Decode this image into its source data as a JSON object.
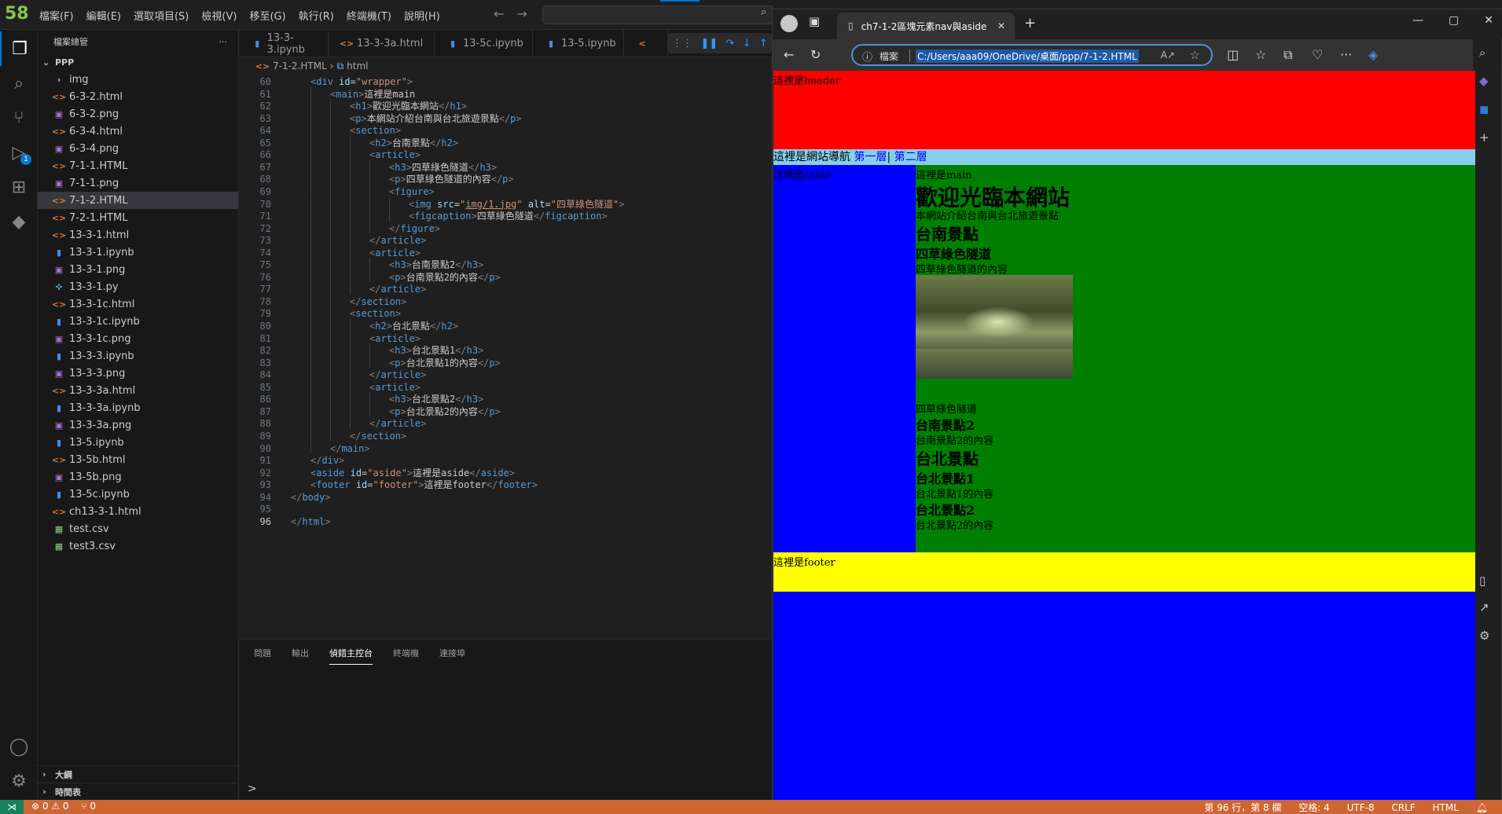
{
  "vscode": {
    "logo": "58",
    "menu": [
      "檔案(F)",
      "編輯(E)",
      "選取項目(S)",
      "檢視(V)",
      "移至(G)",
      "執行(R)",
      "終端機(T)",
      "說明(H)"
    ],
    "explorer": {
      "title": "檔案總管",
      "more": "···",
      "root": "PPP",
      "files": [
        {
          "name": "img",
          "type": "dir"
        },
        {
          "name": "6-3-2.html",
          "type": "html"
        },
        {
          "name": "6-3-2.png",
          "type": "png"
        },
        {
          "name": "6-3-4.html",
          "type": "html"
        },
        {
          "name": "6-3-4.png",
          "type": "png"
        },
        {
          "name": "7-1-1.HTML",
          "type": "html"
        },
        {
          "name": "7-1-1.png",
          "type": "png"
        },
        {
          "name": "7-1-2.HTML",
          "type": "html",
          "selected": true
        },
        {
          "name": "7-2-1.HTML",
          "type": "html"
        },
        {
          "name": "13-3-1.html",
          "type": "html"
        },
        {
          "name": "13-3-1.ipynb",
          "type": "ipynb"
        },
        {
          "name": "13-3-1.png",
          "type": "png"
        },
        {
          "name": "13-3-1.py",
          "type": "py"
        },
        {
          "name": "13-3-1c.html",
          "type": "html"
        },
        {
          "name": "13-3-1c.ipynb",
          "type": "ipynb"
        },
        {
          "name": "13-3-1c.png",
          "type": "png"
        },
        {
          "name": "13-3-3.ipynb",
          "type": "ipynb"
        },
        {
          "name": "13-3-3.png",
          "type": "png"
        },
        {
          "name": "13-3-3a.html",
          "type": "html"
        },
        {
          "name": "13-3-3a.ipynb",
          "type": "ipynb"
        },
        {
          "name": "13-3-3a.png",
          "type": "png"
        },
        {
          "name": "13-5.ipynb",
          "type": "ipynb"
        },
        {
          "name": "13-5b.html",
          "type": "html"
        },
        {
          "name": "13-5b.png",
          "type": "png"
        },
        {
          "name": "13-5c.ipynb",
          "type": "ipynb"
        },
        {
          "name": "ch13-3-1.html",
          "type": "html"
        },
        {
          "name": "test.csv",
          "type": "csv"
        },
        {
          "name": "test3.csv",
          "type": "csv"
        }
      ],
      "outline": "大綱",
      "timeline": "時間表"
    },
    "tabs": [
      "13-3-3.ipynb",
      "13-3-3a.html",
      "13-5c.ipynb",
      "13-5.ipynb"
    ],
    "breadcrumb": {
      "file": "7-1-2.HTML",
      "node": "html"
    },
    "code_lines": [
      {
        "n": "60",
        "indent": 1,
        "html": "<span class='t-br'>&lt;</span><span class='t-tag'>div</span> <span class='t-attr'>id</span>=<span class='t-str'>\"wrapper\"</span><span class='t-br'>&gt;</span>"
      },
      {
        "n": "61",
        "indent": 2,
        "html": "<span class='t-br'>&lt;</span><span class='t-tag'>main</span><span class='t-br'>&gt;</span>這裡是main"
      },
      {
        "n": "62",
        "indent": 3,
        "html": "<span class='t-br'>&lt;</span><span class='t-tag'>h1</span><span class='t-br'>&gt;</span>歡迎光臨本網站<span class='t-br'>&lt;/</span><span class='t-tag'>h1</span><span class='t-br'>&gt;</span>"
      },
      {
        "n": "63",
        "indent": 3,
        "html": "<span class='t-br'>&lt;</span><span class='t-tag'>p</span><span class='t-br'>&gt;</span>本網站介紹台南與台北旅遊景點<span class='t-br'>&lt;/</span><span class='t-tag'>p</span><span class='t-br'>&gt;</span>"
      },
      {
        "n": "64",
        "indent": 3,
        "html": "<span class='t-br'>&lt;</span><span class='t-tag'>section</span><span class='t-br'>&gt;</span>"
      },
      {
        "n": "65",
        "indent": 4,
        "html": "<span class='t-br'>&lt;</span><span class='t-tag'>h2</span><span class='t-br'>&gt;</span>台南景點<span class='t-br'>&lt;/</span><span class='t-tag'>h2</span><span class='t-br'>&gt;</span>"
      },
      {
        "n": "66",
        "indent": 4,
        "html": "<span class='t-br'>&lt;</span><span class='t-tag'>article</span><span class='t-br'>&gt;</span>"
      },
      {
        "n": "67",
        "indent": 5,
        "html": "<span class='t-br'>&lt;</span><span class='t-tag'>h3</span><span class='t-br'>&gt;</span>四草綠色隧道<span class='t-br'>&lt;/</span><span class='t-tag'>h3</span><span class='t-br'>&gt;</span>"
      },
      {
        "n": "68",
        "indent": 5,
        "html": "<span class='t-br'>&lt;</span><span class='t-tag'>p</span><span class='t-br'>&gt;</span>四草綠色隧道的內容<span class='t-br'>&lt;/</span><span class='t-tag'>p</span><span class='t-br'>&gt;</span>"
      },
      {
        "n": "69",
        "indent": 5,
        "html": "<span class='t-br'>&lt;</span><span class='t-tag'>figure</span><span class='t-br'>&gt;</span>"
      },
      {
        "n": "70",
        "indent": 6,
        "html": "<span class='t-br'>&lt;</span><span class='t-tag'>img</span> <span class='t-attr'>src</span>=<span class='t-str'>\"<u>img/1.jpg</u>\"</span> <span class='t-attr'>alt</span>=<span class='t-str'>\"四草綠色隧道\"</span><span class='t-br'>&gt;</span>"
      },
      {
        "n": "71",
        "indent": 6,
        "html": "<span class='t-br'>&lt;</span><span class='t-tag'>figcaption</span><span class='t-br'>&gt;</span>四草綠色隧道<span class='t-br'>&lt;/</span><span class='t-tag'>figcaption</span><span class='t-br'>&gt;</span>"
      },
      {
        "n": "72",
        "indent": 5,
        "html": "<span class='t-br'>&lt;/</span><span class='t-tag'>figure</span><span class='t-br'>&gt;</span>"
      },
      {
        "n": "73",
        "indent": 4,
        "html": "<span class='t-br'>&lt;/</span><span class='t-tag'>article</span><span class='t-br'>&gt;</span>"
      },
      {
        "n": "74",
        "indent": 4,
        "html": "<span class='t-br'>&lt;</span><span class='t-tag'>article</span><span class='t-br'>&gt;</span>"
      },
      {
        "n": "75",
        "indent": 5,
        "html": "<span class='t-br'>&lt;</span><span class='t-tag'>h3</span><span class='t-br'>&gt;</span>台南景點2<span class='t-br'>&lt;/</span><span class='t-tag'>h3</span><span class='t-br'>&gt;</span>"
      },
      {
        "n": "76",
        "indent": 5,
        "html": "<span class='t-br'>&lt;</span><span class='t-tag'>p</span><span class='t-br'>&gt;</span>台南景點2的內容<span class='t-br'>&lt;/</span><span class='t-tag'>p</span><span class='t-br'>&gt;</span>"
      },
      {
        "n": "77",
        "indent": 4,
        "html": "<span class='t-br'>&lt;/</span><span class='t-tag'>article</span><span class='t-br'>&gt;</span>"
      },
      {
        "n": "78",
        "indent": 3,
        "html": "<span class='t-br'>&lt;/</span><span class='t-tag'>section</span><span class='t-br'>&gt;</span>"
      },
      {
        "n": "79",
        "indent": 3,
        "html": "<span class='t-br'>&lt;</span><span class='t-tag'>section</span><span class='t-br'>&gt;</span>"
      },
      {
        "n": "80",
        "indent": 4,
        "html": "<span class='t-br'>&lt;</span><span class='t-tag'>h2</span><span class='t-br'>&gt;</span>台北景點<span class='t-br'>&lt;/</span><span class='t-tag'>h2</span><span class='t-br'>&gt;</span>"
      },
      {
        "n": "81",
        "indent": 4,
        "html": "<span class='t-br'>&lt;</span><span class='t-tag'>article</span><span class='t-br'>&gt;</span>"
      },
      {
        "n": "82",
        "indent": 5,
        "html": "<span class='t-br'>&lt;</span><span class='t-tag'>h3</span><span class='t-br'>&gt;</span>台北景點1<span class='t-br'>&lt;/</span><span class='t-tag'>h3</span><span class='t-br'>&gt;</span>"
      },
      {
        "n": "83",
        "indent": 5,
        "html": "<span class='t-br'>&lt;</span><span class='t-tag'>p</span><span class='t-br'>&gt;</span>台北景點1的內容<span class='t-br'>&lt;/</span><span class='t-tag'>p</span><span class='t-br'>&gt;</span>"
      },
      {
        "n": "84",
        "indent": 4,
        "html": "<span class='t-br'>&lt;/</span><span class='t-tag'>article</span><span class='t-br'>&gt;</span>"
      },
      {
        "n": "85",
        "indent": 4,
        "html": "<span class='t-br'>&lt;</span><span class='t-tag'>article</span><span class='t-br'>&gt;</span>"
      },
      {
        "n": "86",
        "indent": 5,
        "html": "<span class='t-br'>&lt;</span><span class='t-tag'>h3</span><span class='t-br'>&gt;</span>台北景點2<span class='t-br'>&lt;/</span><span class='t-tag'>h3</span><span class='t-br'>&gt;</span>"
      },
      {
        "n": "87",
        "indent": 5,
        "html": "<span class='t-br'>&lt;</span><span class='t-tag'>p</span><span class='t-br'>&gt;</span>台北景點2的內容<span class='t-br'>&lt;/</span><span class='t-tag'>p</span><span class='t-br'>&gt;</span>"
      },
      {
        "n": "88",
        "indent": 4,
        "html": "<span class='t-br'>&lt;/</span><span class='t-tag'>article</span><span class='t-br'>&gt;</span>"
      },
      {
        "n": "89",
        "indent": 3,
        "html": "<span class='t-br'>&lt;/</span><span class='t-tag'>section</span><span class='t-br'>&gt;</span>"
      },
      {
        "n": "90",
        "indent": 2,
        "html": "<span class='t-br'>&lt;/</span><span class='t-tag'>main</span><span class='t-br'>&gt;</span>"
      },
      {
        "n": "91",
        "indent": 1,
        "html": "<span class='t-br'>&lt;/</span><span class='t-tag'>div</span><span class='t-br'>&gt;</span>"
      },
      {
        "n": "92",
        "indent": 1,
        "html": "<span class='t-br'>&lt;</span><span class='t-tag'>aside</span> <span class='t-attr'>id</span>=<span class='t-str'>\"aside\"</span><span class='t-br'>&gt;</span>這裡是aside<span class='t-br'>&lt;/</span><span class='t-tag'>aside</span><span class='t-br'>&gt;</span>"
      },
      {
        "n": "93",
        "indent": 1,
        "html": "<span class='t-br'>&lt;</span><span class='t-tag'>footer</span> <span class='t-attr'>id</span>=<span class='t-str'>\"footer\"</span><span class='t-br'>&gt;</span>這裡是footer<span class='t-br'>&lt;/</span><span class='t-tag'>footer</span><span class='t-br'>&gt;</span>"
      },
      {
        "n": "94",
        "indent": 0,
        "html": "<span class='t-br'>&lt;/</span><span class='t-tag'>body</span><span class='t-br'>&gt;</span>"
      },
      {
        "n": "95",
        "indent": 0,
        "html": ""
      },
      {
        "n": "96",
        "indent": 0,
        "html": "<span class='t-br'>&lt;/</span><span class='t-tag'>html</span><span class='t-br'>&gt;</span>",
        "current": true
      }
    ],
    "panel_tabs": [
      "問題",
      "輸出",
      "偵錯主控台",
      "終端機",
      "連接埠"
    ],
    "panel_active": 2,
    "panel_prompt": ">",
    "status": {
      "errors": "⊗ 0 ⚠ 0",
      "ports": "⑂ 0",
      "position": "第 96 行，第 8 欄",
      "spaces": "空格: 4",
      "encoding": "UTF-8",
      "eol": "CRLF",
      "language": "HTML"
    }
  },
  "browser": {
    "tab_title": "ch7-1-2區塊元素nav與aside",
    "address_scheme": "檔案",
    "address_url": "C:/Users/aaa09/OneDrive/桌面/ppp/7-1-2.HTML",
    "page": {
      "header": "這裡是header",
      "nav_prefix": "這裡是網站導航 ",
      "nav_link1": "第一層",
      "nav_sep": "| ",
      "nav_link2": "第二層",
      "aside": "這裡是aside",
      "main_label": "這裡是main",
      "h1": "歡迎光臨本網站",
      "intro": "本網站介紹台南與台北旅遊景點",
      "tainan_h2": "台南景點",
      "a1_h3": "四草綠色隧道",
      "a1_p": "四草綠色隧道的內容",
      "figcaption": "四草綠色隧道",
      "a2_h3": "台南景點2",
      "a2_p": "台南景點2的內容",
      "taipei_h2": "台北景點",
      "a3_h3": "台北景點1",
      "a3_p": "台北景點1的內容",
      "a4_h3": "台北景點2",
      "a4_p": "台北景點2的內容",
      "footer": "這裡是footer"
    }
  },
  "colors": {
    "header": "#ff0000",
    "nav": "#87ceeb",
    "aside": "#0000ff",
    "main": "#008000",
    "footer": "#ffff00",
    "statusbar": "#cc6633"
  }
}
